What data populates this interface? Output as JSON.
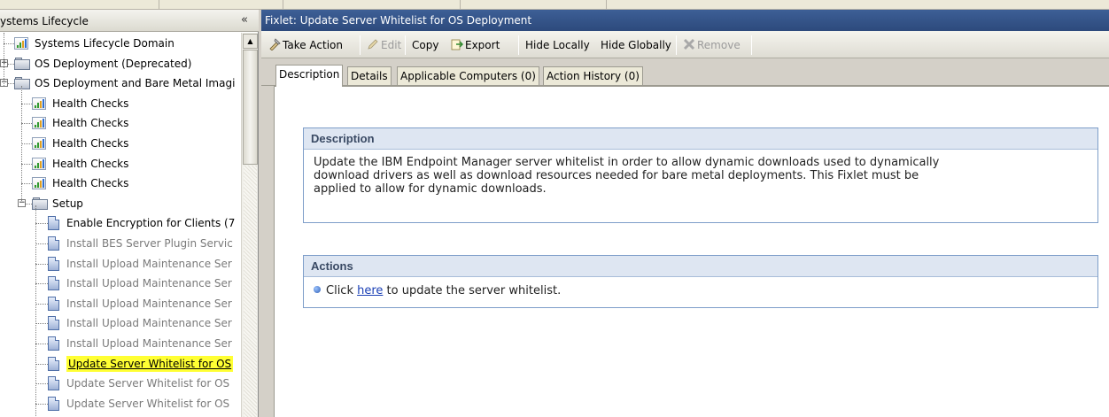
{
  "left_panel": {
    "title": "ystems Lifecycle",
    "collapse_label": "«",
    "tree": [
      {
        "label": "Systems Lifecycle Domain",
        "icon": "chart-icon",
        "expander": "",
        "state": "normal"
      },
      {
        "label": "OS Deployment (Deprecated)",
        "icon": "folder-icon",
        "expander": "+",
        "state": "normal"
      },
      {
        "label": "OS Deployment and Bare Metal Imagi",
        "icon": "folder-icon",
        "expander": "-",
        "state": "normal"
      },
      {
        "label": "Health Checks",
        "icon": "chart-icon",
        "expander": "",
        "state": "normal"
      },
      {
        "label": "Health Checks",
        "icon": "chart-icon",
        "expander": "",
        "state": "normal"
      },
      {
        "label": "Health Checks",
        "icon": "chart-icon",
        "expander": "",
        "state": "normal"
      },
      {
        "label": "Health Checks",
        "icon": "chart-icon",
        "expander": "",
        "state": "normal"
      },
      {
        "label": "Health Checks",
        "icon": "chart-icon",
        "expander": "",
        "state": "normal"
      },
      {
        "label": "Setup",
        "icon": "folder-icon",
        "expander": "-",
        "state": "normal"
      },
      {
        "label": "Enable Encryption for Clients (7",
        "icon": "document-icon",
        "expander": "",
        "state": "normal"
      },
      {
        "label": "Install BES Server Plugin Servic",
        "icon": "document-icon",
        "expander": "",
        "state": "gray"
      },
      {
        "label": "Install Upload Maintenance Ser",
        "icon": "document-icon",
        "expander": "",
        "state": "gray"
      },
      {
        "label": "Install Upload Maintenance Ser",
        "icon": "document-icon",
        "expander": "",
        "state": "gray"
      },
      {
        "label": "Install Upload Maintenance Ser",
        "icon": "document-icon",
        "expander": "",
        "state": "gray"
      },
      {
        "label": "Install Upload Maintenance Ser",
        "icon": "document-icon",
        "expander": "",
        "state": "gray"
      },
      {
        "label": "Install Upload Maintenance Ser",
        "icon": "document-icon",
        "expander": "",
        "state": "gray"
      },
      {
        "label": "Update Server Whitelist for OS",
        "icon": "document-icon",
        "expander": "",
        "state": "selected"
      },
      {
        "label": "Update Server Whitelist for OS",
        "icon": "document-icon",
        "expander": "",
        "state": "gray"
      },
      {
        "label": "Update Server Whitelist for OS",
        "icon": "document-icon",
        "expander": "",
        "state": "gray"
      }
    ]
  },
  "right_panel": {
    "title": "Fixlet: Update Server Whitelist for OS Deployment",
    "toolbar": {
      "take_action": "Take Action",
      "edit": "Edit",
      "copy": "Copy",
      "export": "Export",
      "hide_locally": "Hide Locally",
      "hide_globally": "Hide Globally",
      "remove": "Remove"
    },
    "tabs": [
      "Description",
      "Details",
      "Applicable Computers (0)",
      "Action History (0)"
    ],
    "description": {
      "heading": "Description",
      "line1": "Update the IBM Endpoint Manager server whitelist in order to allow dynamic downloads used to dynamically",
      "line2": "download drivers as well as download resources needed for bare metal deployments. This Fixlet must be",
      "line3": "applied to allow for dynamic downloads."
    },
    "actions": {
      "heading": "Actions",
      "prefix": "Click ",
      "link": "here",
      "suffix": " to update the server whitelist."
    }
  },
  "colors": {
    "title_bar": "#2d4a7c",
    "box_border": "#7e9ec9",
    "box_header": "#dee6f2",
    "selection_highlight": "#ffff33",
    "link": "#1a3fb5"
  }
}
